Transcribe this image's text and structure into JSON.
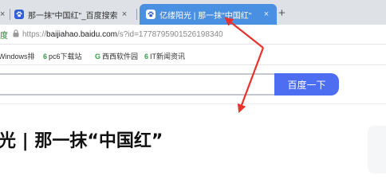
{
  "tabs": {
    "edge_close": "×",
    "inactive": {
      "title": "那一抹\"中国红\"_百度搜索",
      "close": "×"
    },
    "active": {
      "title": "亿缕阳光 | 那一抹\"中国红\"",
      "close": "×"
    },
    "new_tab": "+"
  },
  "address": {
    "secure_label": "度",
    "scheme": "https://",
    "host": "baijiahao.baidu.com",
    "path": "/s?id=1778795901526198340"
  },
  "bookmarks": [
    {
      "icon": "",
      "label": "Windows排"
    },
    {
      "icon": "6",
      "label": "pc6下载站"
    },
    {
      "icon": "G",
      "label": "西西软件园"
    },
    {
      "icon": "6",
      "label": "IT新闻资讯"
    }
  ],
  "search": {
    "button_label": "百度一下",
    "query": ""
  },
  "article": {
    "headline": "光 | 那一抹“中国红”"
  },
  "colors": {
    "active_tab": "#4a90e2",
    "search_button": "#4e6ef2",
    "arrow": "#e8322b"
  }
}
